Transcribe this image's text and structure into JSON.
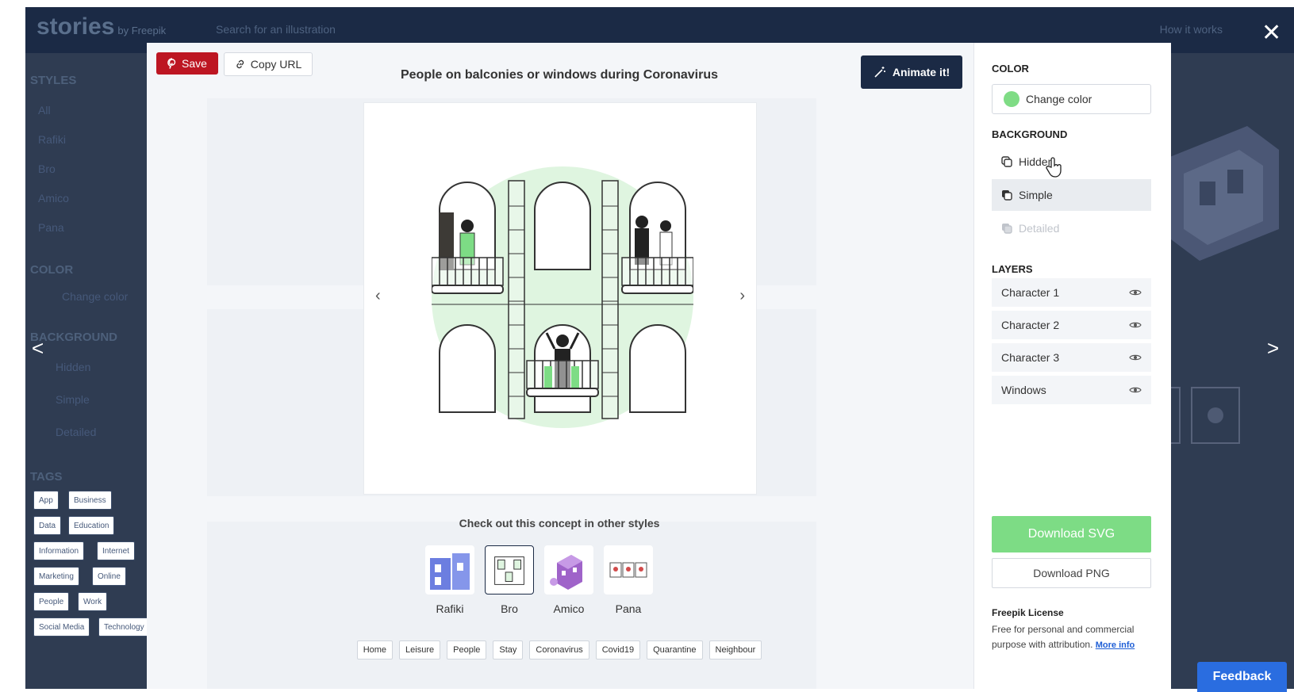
{
  "background_page": {
    "logo": "stories",
    "logo_by": "by Freepik",
    "search_placeholder": "Search for an illustration",
    "how_it_works": "How it works",
    "styles_heading": "STYLES",
    "styles": [
      "All",
      "Rafiki",
      "Bro",
      "Amico",
      "Pana"
    ],
    "color_heading": "COLOR",
    "change_color": "Change color",
    "background_heading": "BACKGROUND",
    "background_options": [
      "Hidden",
      "Simple",
      "Detailed"
    ],
    "tags_heading": "TAGS",
    "tags": [
      "App",
      "Business",
      "Data",
      "Education",
      "Information",
      "Internet",
      "Marketing",
      "Online",
      "People",
      "Work",
      "Social Media",
      "Technology"
    ]
  },
  "modal": {
    "save_label": "Save",
    "copy_url_label": "Copy URL",
    "title": "People on balconies or windows during Coronavirus",
    "animate_label": "Animate it!",
    "prev_arrow": "‹",
    "next_arrow": "›",
    "concept_heading": "Check out this concept in other styles",
    "styles": [
      {
        "label": "Rafiki",
        "selected": false
      },
      {
        "label": "Bro",
        "selected": true
      },
      {
        "label": "Amico",
        "selected": false
      },
      {
        "label": "Pana",
        "selected": false
      }
    ],
    "tags": [
      "Home",
      "Leisure",
      "People",
      "Stay",
      "Coronavirus",
      "Covid19",
      "Quarantine",
      "Neighbour"
    ]
  },
  "sidebar": {
    "color_heading": "COLOR",
    "change_color": "Change color",
    "current_color": "#7fdc85",
    "background_heading": "BACKGROUND",
    "background_options": [
      {
        "label": "Hidden",
        "state": "normal"
      },
      {
        "label": "Simple",
        "state": "selected"
      },
      {
        "label": "Detailed",
        "state": "disabled"
      }
    ],
    "layers_heading": "LAYERS",
    "layers": [
      "Character 1",
      "Character 2",
      "Character 3",
      "Windows"
    ],
    "download_svg": "Download SVG",
    "download_png": "Download PNG",
    "license_title": "Freepik License",
    "license_text": "Free for personal and commercial purpose with attribution.",
    "more_info": "More info"
  },
  "overlay": {
    "close": "✕",
    "prev": "<",
    "next": ">",
    "feedback": "Feedback"
  },
  "colors": {
    "accent_green": "#7ddc85",
    "save_red": "#bd1622",
    "navy": "#1b2a45",
    "feedback_blue": "#2a6de0"
  }
}
